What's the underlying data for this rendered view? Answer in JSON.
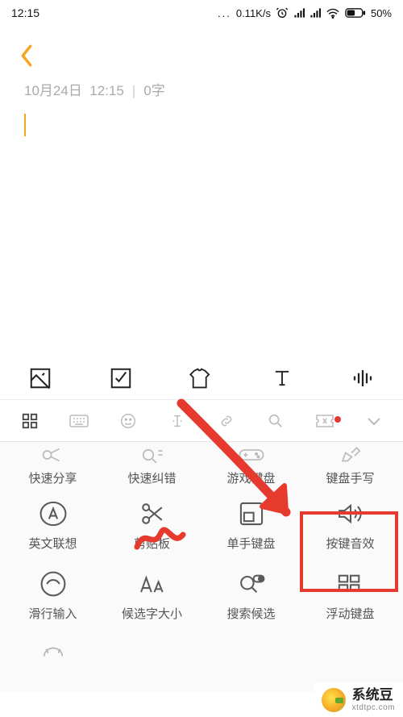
{
  "statusbar": {
    "time": "12:15",
    "dots": "...",
    "speed": "0.11K/s",
    "battery_pct": "50%"
  },
  "note": {
    "date": "10月24日",
    "time": "12:15",
    "char_count": "0字"
  },
  "kb_grid": {
    "row_partial": [
      {
        "label": "快速分享"
      },
      {
        "label": "快速纠错"
      },
      {
        "label": "游戏键盘"
      },
      {
        "label": "键盘手写"
      }
    ],
    "row2": [
      {
        "label": "英文联想"
      },
      {
        "label": "剪贴板"
      },
      {
        "label": "单手键盘"
      },
      {
        "label": "按键音效"
      }
    ],
    "row3": [
      {
        "label": "滑行输入"
      },
      {
        "label": "候选字大小"
      },
      {
        "label": "搜索候选"
      },
      {
        "label": "浮动键盘"
      }
    ]
  },
  "watermark": {
    "name": "系统豆",
    "site": "xtdtpc.com"
  }
}
